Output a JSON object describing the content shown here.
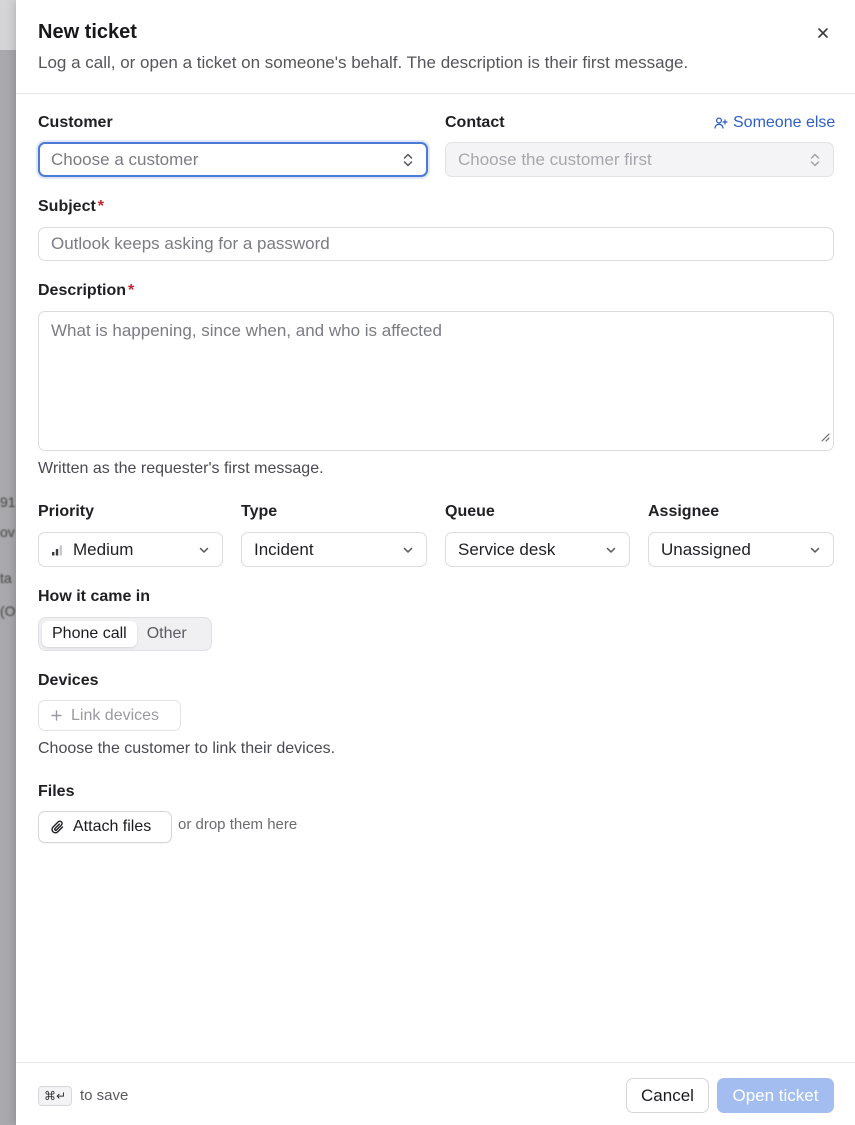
{
  "header": {
    "title": "New ticket",
    "subtitle": "Log a call, or open a ticket on someone's behalf. The description is their first message."
  },
  "customer": {
    "label": "Customer",
    "placeholder": "Choose a customer"
  },
  "contact": {
    "label": "Contact",
    "placeholder": "Choose the customer first",
    "someone_else": "Someone else"
  },
  "subject": {
    "label": "Subject",
    "required_mark": "*",
    "placeholder": "Outlook keeps asking for a password"
  },
  "description": {
    "label": "Description",
    "required_mark": "*",
    "placeholder": "What is happening, since when, and who is affected",
    "hint": "Written as the requester's first message."
  },
  "priority": {
    "label": "Priority",
    "value": "Medium"
  },
  "type": {
    "label": "Type",
    "value": "Incident"
  },
  "queue": {
    "label": "Queue",
    "value": "Service desk"
  },
  "assignee": {
    "label": "Assignee",
    "value": "Unassigned"
  },
  "channel": {
    "label": "How it came in",
    "options": [
      "Phone call",
      "Other"
    ],
    "selected": "Phone call"
  },
  "devices": {
    "label": "Devices",
    "button": "Link devices",
    "hint": "Choose the customer to link their devices."
  },
  "files": {
    "label": "Files",
    "button": "Attach files",
    "hint": "or drop them here"
  },
  "footer": {
    "shortcut": "⌘↵",
    "shortcut_hint": "to save",
    "cancel": "Cancel",
    "submit": "Open ticket"
  },
  "colors": {
    "accent": "#4b7bd6",
    "link": "#2f5fc4",
    "required": "#c0262d",
    "primary_disabled": "#a3bdf0"
  },
  "icons": [
    "close-icon",
    "chevron-updown-icon",
    "chevron-down-icon",
    "user-plus-icon",
    "signal-bars-icon",
    "plus-icon",
    "paperclip-icon",
    "resize-grip-icon"
  ]
}
